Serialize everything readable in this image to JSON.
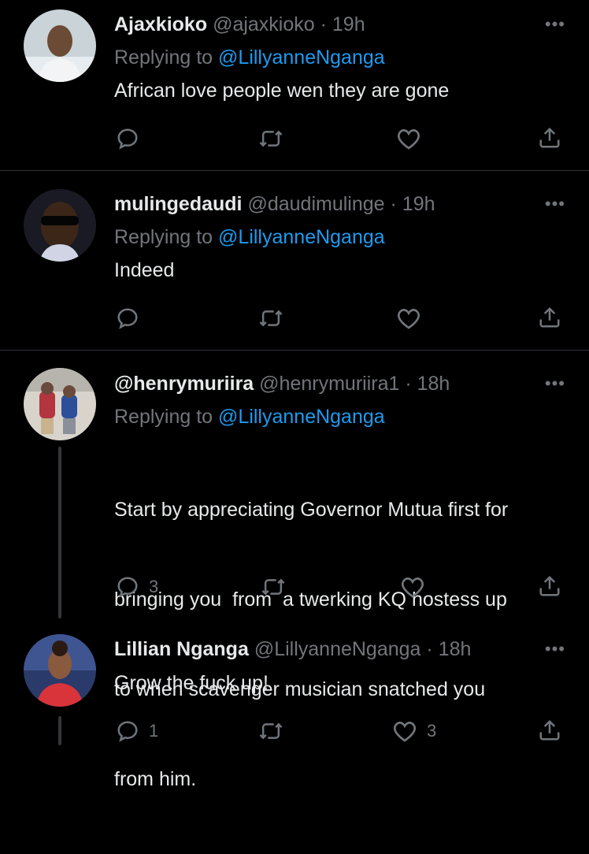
{
  "tweets": [
    {
      "display_name": "Ajaxkioko",
      "handle": "@ajaxkioko",
      "separator": "·",
      "time": "19h",
      "replying_prefix": "Replying to",
      "replying_to": "@LillyanneNganga",
      "text": "African love people wen they are gone",
      "reply_count": "",
      "retweet_count": "",
      "like_count": "",
      "more_label": "•••"
    },
    {
      "display_name": "mulingedaudi",
      "handle": "@daudimulinge",
      "separator": "·",
      "time": "19h",
      "replying_prefix": "Replying to",
      "replying_to": "@LillyanneNganga",
      "text": "Indeed",
      "reply_count": "",
      "retweet_count": "",
      "like_count": "",
      "more_label": "•••"
    },
    {
      "display_name": "@henrymuriira",
      "handle": "@henrymuriira1",
      "separator": "·",
      "time": "18h",
      "replying_prefix": "Replying to",
      "replying_to": "@LillyanneNganga",
      "text_lines": [
        "Start by appreciating Governor Mutua first for",
        "bringing you  from  a twerking KQ hostess up",
        "to when scavenger musician snatched you",
        "from him."
      ],
      "reply_count": "3",
      "retweet_count": "",
      "like_count": "",
      "more_label": "•••"
    },
    {
      "display_name": "Lillian Nganga",
      "handle": "@LillyanneNganga",
      "separator": "·",
      "time": "18h",
      "text": "Grow the fuck up!",
      "reply_count": "1",
      "retweet_count": "",
      "like_count": "3",
      "more_label": "•••"
    }
  ],
  "icons": {
    "reply": "reply-icon",
    "retweet": "retweet-icon",
    "like": "like-icon",
    "share": "share-icon",
    "more": "more-icon"
  },
  "colors": {
    "background": "#000000",
    "text": "#e7e9ea",
    "muted": "#71767b",
    "mention": "#1d9bf0",
    "divider": "#2f3336"
  }
}
